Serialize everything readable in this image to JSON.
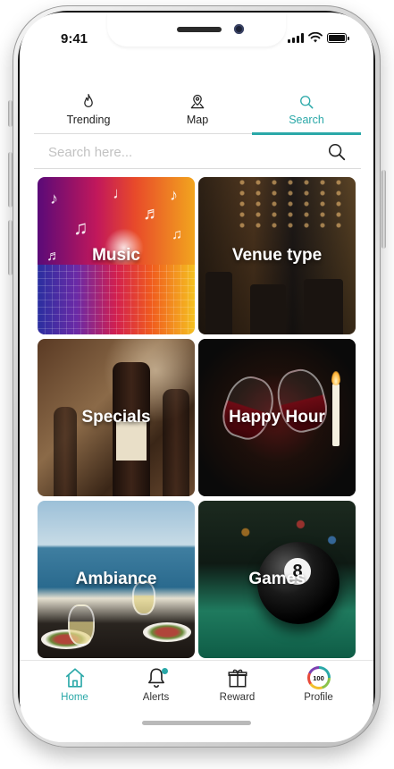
{
  "status_bar": {
    "time": "9:41"
  },
  "top_tabs": [
    {
      "label": "Trending",
      "icon": "flame-icon",
      "active": false
    },
    {
      "label": "Map",
      "icon": "map-pin-icon",
      "active": false
    },
    {
      "label": "Search",
      "icon": "search-icon",
      "active": true
    }
  ],
  "search": {
    "placeholder": "Search here...",
    "value": ""
  },
  "categories": [
    {
      "label": "Music"
    },
    {
      "label": "Venue type"
    },
    {
      "label": "Specials"
    },
    {
      "label": "Happy Hour"
    },
    {
      "label": "Ambiance"
    },
    {
      "label": "Games"
    }
  ],
  "bottom_nav": [
    {
      "label": "Home",
      "icon": "home-icon",
      "active": true
    },
    {
      "label": "Alerts",
      "icon": "bell-icon",
      "active": false
    },
    {
      "label": "Reward",
      "icon": "gift-icon",
      "active": false
    },
    {
      "label": "Profile",
      "icon": "profile-score-icon",
      "active": false,
      "score": "100"
    }
  ],
  "colors": {
    "accent": "#2aa8a8"
  }
}
